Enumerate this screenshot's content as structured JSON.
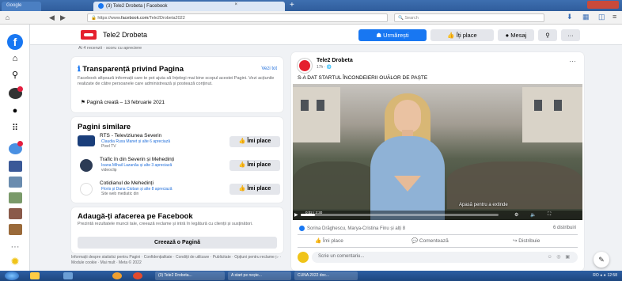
{
  "browser": {
    "tabs": [
      {
        "label": "Google"
      },
      {
        "label": "(3) Tele2 Drobeta | Facebook",
        "close": "×"
      }
    ],
    "new_tab": "+",
    "url_prefix": "https://www.",
    "url_domain": "facebook.com",
    "url_path": "/Tele2Drobeta2022",
    "search_placeholder": "Search"
  },
  "page_header": {
    "name": "Tele2 Drobeta",
    "follow_label": "Urmărești",
    "like_label": "Îți place",
    "message_label": "Mesaj"
  },
  "transparency": {
    "cut_line": "Ai 4 recenzii · scoru cu apreciere",
    "title": "Transparență privind Pagina",
    "see_all": "Vezi tot",
    "description": "Facebook afișează informații care te pot ajuta să înțelegi mai bine scopul acestei Pagini. Vezi acțiunile realizate de către persoanele care administrează și postează conținut.",
    "created": "Pagină creată – 13 februarie 2021"
  },
  "similar": {
    "title": "Pagini similare",
    "items": [
      {
        "name": "RTS - Televiziunea Severin",
        "sub1": "Claudia Ruxa Manet și alte 6 apreciază",
        "sub2": "Pixel TV",
        "button": "Îmi place"
      },
      {
        "name": "Trafic în din Severin și Mehedinți",
        "sub1": "Ioana Mihail Lazanău și alte 3 apreciază",
        "sub2": "videoclip",
        "button": "Îmi place"
      },
      {
        "name": "Cotidianul de Mehedinți",
        "sub1": "Floris și Dana Cioban și alte 8 apreciază",
        "sub2": "Site web mediatic din",
        "button": "Îmi place"
      }
    ]
  },
  "business": {
    "title": "Adaugă-ți afacerea pe Facebook",
    "description": "Prezintă rezultatele muncii tale, creează reclame și intră în legătură cu clienții și susținători.",
    "button": "Creează o Pagină"
  },
  "footer": {
    "text": "Informații despre statistici pentru Pagini · Confidențialitate · Condiții de utilizare · Publicitate · Opțiuni pentru reclame ▷ · Module cookie · Mai mult · Meta © 2022"
  },
  "post": {
    "author": "Tele2 Drobeta",
    "time": "17h · 🌐",
    "more": "···",
    "text": "S-A DAT STARTUL ÎNCONDEIERII OUĂLOR DE PAȘTE",
    "video_caption": "Apasă pentru a extinde",
    "video_progress": 0.07,
    "video_time": "0:02 / 2:30",
    "reactions": "Sorina Drăghescu, Marya-Cristina Finu și alți 8",
    "shares": "6 distribuiri",
    "like": "Îmi place",
    "comment": "Comentează",
    "share": "Distribuie",
    "comment_placeholder": "Scrie un comentariu..."
  },
  "taskbar": {
    "items": [
      {
        "label": "(3) Tele2 Drobeta..."
      },
      {
        "label": "A start pe nește..."
      },
      {
        "label": "CUNA 2022 doc..."
      }
    ],
    "tray": "RO ◂ ⯅ 12:58"
  },
  "colors": {
    "facebook_blue": "#1877f2",
    "tele2_red": "#e5202e",
    "page_bg": "#f0f2f5",
    "button_gray": "#e4e6eb"
  }
}
